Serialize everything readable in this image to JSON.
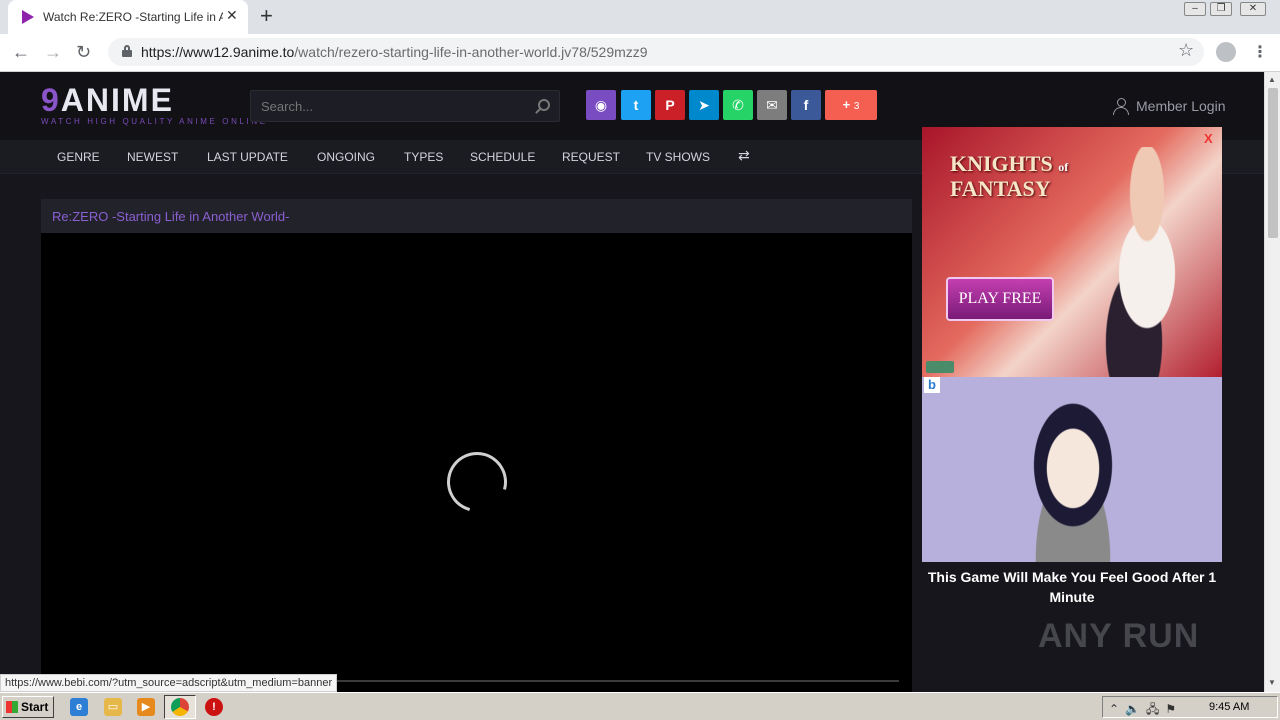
{
  "browser": {
    "tab_title": "Watch Re:ZERO -Starting Life in Another World-",
    "url_host": "https://www12.9anime.to",
    "url_path": "/watch/rezero-starting-life-in-another-world.jv78/529mzz9",
    "status_url": "https://www.bebi.com/?utm_source=adscript&utm_medium=banner"
  },
  "site": {
    "logo_nine": "9",
    "logo_rest": "ANIME",
    "tagline": "WATCH HIGH QUALITY ANIME ONLINE",
    "search_placeholder": "Search...",
    "share_count": "3",
    "member_login": "Member Login"
  },
  "share_buttons": [
    {
      "name": "discord",
      "color": "#7a4cc2"
    },
    {
      "name": "twitter",
      "color": "#1da1f2"
    },
    {
      "name": "pinterest",
      "color": "#cb2027"
    },
    {
      "name": "telegram",
      "color": "#0088cc"
    },
    {
      "name": "whatsapp",
      "color": "#25d366"
    },
    {
      "name": "email",
      "color": "#7d7d7d"
    },
    {
      "name": "facebook",
      "color": "#3b5998"
    },
    {
      "name": "more",
      "color": "#f45f52"
    }
  ],
  "nav": {
    "items": [
      "GENRE",
      "NEWEST",
      "LAST UPDATE",
      "ONGOING",
      "TYPES",
      "SCHEDULE",
      "REQUEST",
      "TV SHOWS"
    ]
  },
  "player": {
    "title": "Re:ZERO -Starting Life in Another World-"
  },
  "ads": {
    "close": "X",
    "ad1_title_line1": "KNIGHTS",
    "ad1_title_of": "of",
    "ad1_title_line2": "FANTASY",
    "ad1_button": "PLAY FREE",
    "ad2_badge": "b",
    "ad2_caption": "This Game Will Make You Feel Good After 1 Minute"
  },
  "watermark": "ANY RUN",
  "taskbar": {
    "start": "Start",
    "clock": "9:45 AM"
  }
}
